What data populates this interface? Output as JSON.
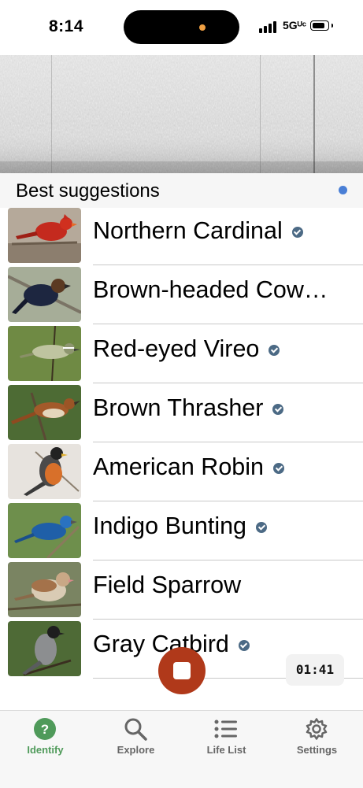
{
  "status_bar": {
    "time": "8:14",
    "network": "5Gᵁᶜ",
    "icons": [
      "signal-icon",
      "battery-icon"
    ]
  },
  "spectrogram": {
    "icon": "spectrogram"
  },
  "suggestions": {
    "title": "Best suggestions",
    "items": [
      {
        "name": "Northern Cardinal",
        "verified": true
      },
      {
        "name": "Brown-headed Cow…",
        "verified": false
      },
      {
        "name": "Red-eyed Vireo",
        "verified": true
      },
      {
        "name": "Brown Thrasher",
        "verified": true
      },
      {
        "name": "American Robin",
        "verified": true
      },
      {
        "name": "Indigo Bunting",
        "verified": true
      },
      {
        "name": "Field Sparrow",
        "verified": false
      },
      {
        "name": "Gray Catbird",
        "verified": true
      }
    ]
  },
  "recording": {
    "timer": "01:41",
    "stop_icon": "stop-icon",
    "accent": "#b0391a"
  },
  "tabs": [
    {
      "label": "Identify",
      "icon": "question-circle-icon",
      "active": true
    },
    {
      "label": "Explore",
      "icon": "search-icon",
      "active": false
    },
    {
      "label": "Life List",
      "icon": "list-icon",
      "active": false
    },
    {
      "label": "Settings",
      "icon": "gear-icon",
      "active": false
    }
  ],
  "colors": {
    "active_tab": "#4f9a5a",
    "verified_badge": "#4c6a85",
    "live_dot": "#4a7fd6"
  }
}
